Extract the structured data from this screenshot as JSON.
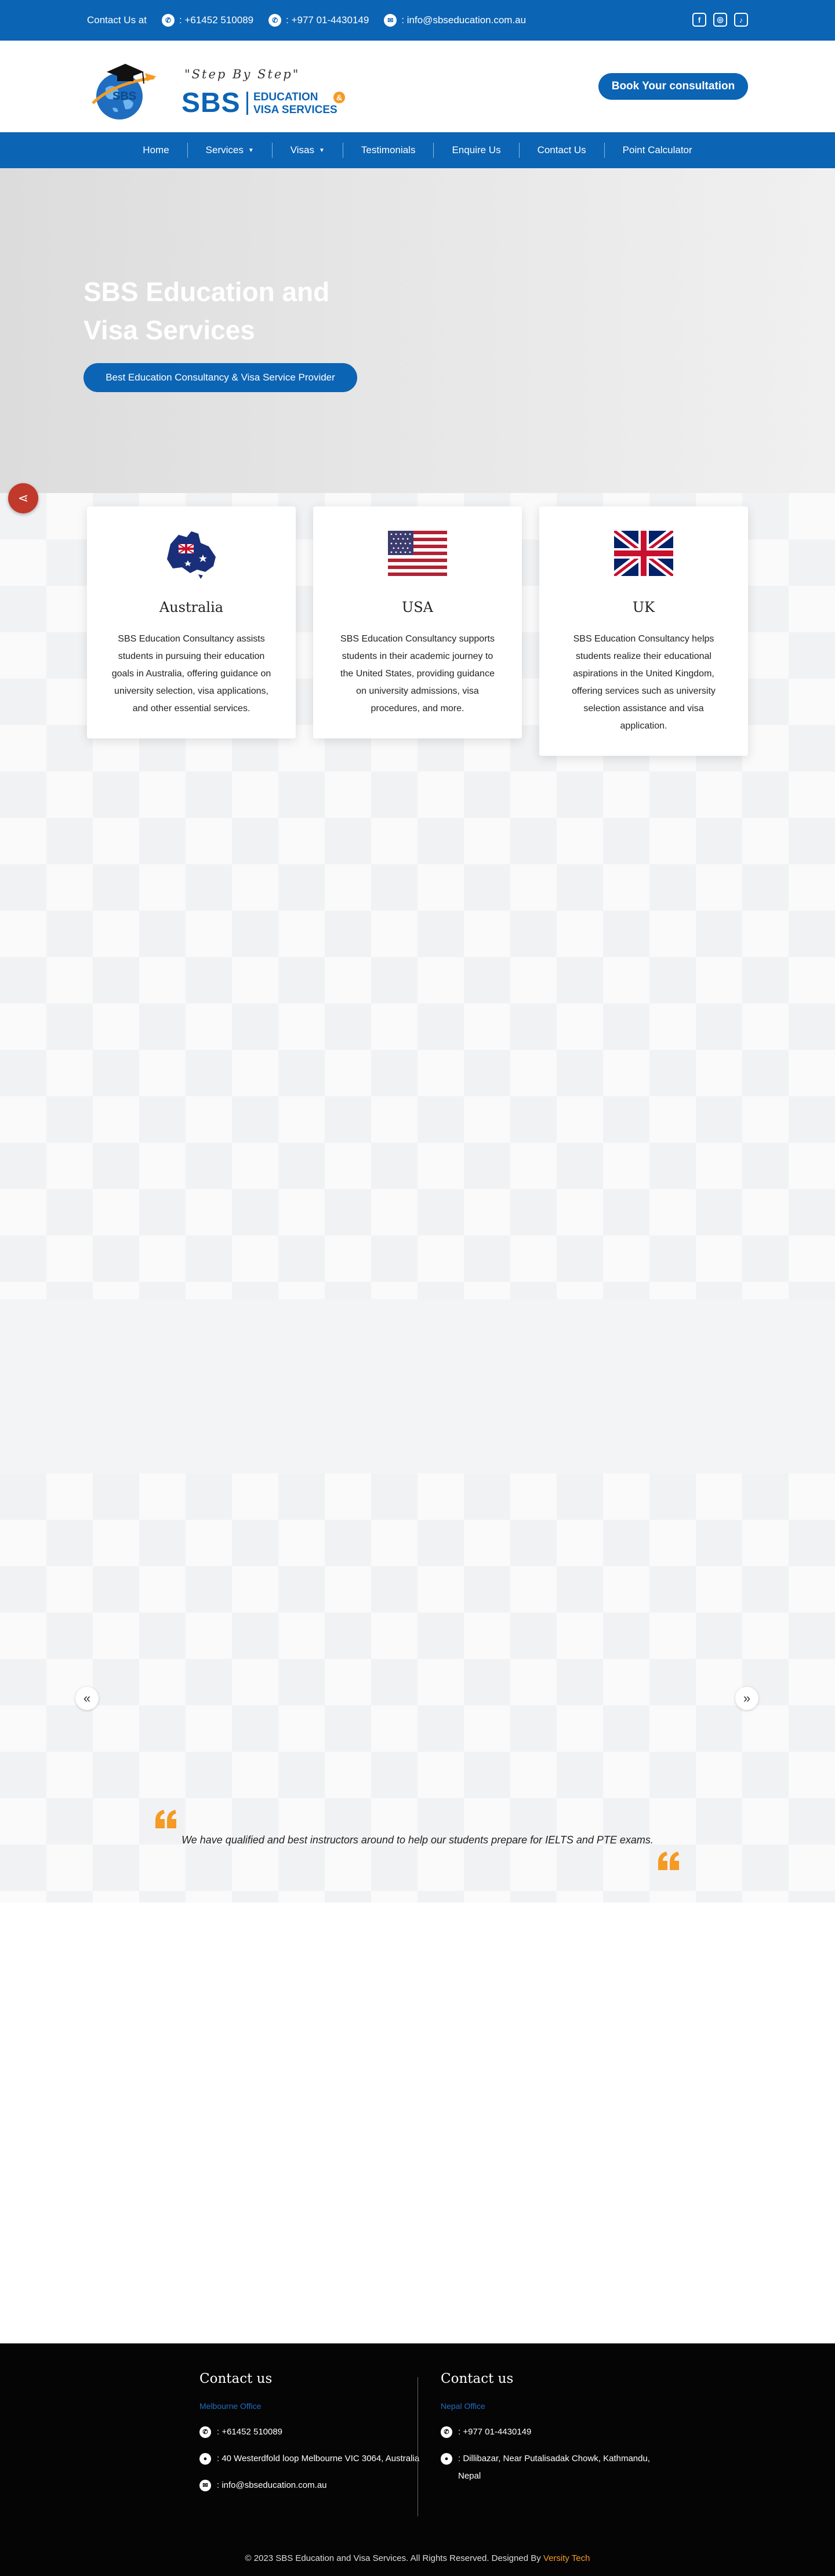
{
  "topbar": {
    "contact_label": "Contact Us at",
    "phone_au": ": +61452 510089",
    "phone_np": ": +977 01-4430149",
    "email": ": info@sbseducation.com.au",
    "social": [
      "facebook-icon",
      "instagram-icon",
      "tiktok-icon"
    ]
  },
  "header": {
    "tagline": "\"Step By Step\"",
    "brand": "SBS",
    "brand_line1": "EDUCATION",
    "brand_line2": "VISA SERVICES",
    "amp": "&",
    "book_button": "Book Your consultation"
  },
  "nav": {
    "items": [
      "Home",
      "Services",
      "Visas",
      "Testimonials",
      "Enquire Us",
      "Contact Us",
      "Point Calculator"
    ]
  },
  "hero": {
    "title": "SBS Education and Visa Services",
    "button": "Best Education Consultancy & Visa Service Provider"
  },
  "cards": [
    {
      "name": "Australia",
      "text": "SBS Education Consultancy assists students in pursuing their education goals in Australia, offering guidance on university selection, visa applications, and other essential services."
    },
    {
      "name": "USA",
      "text": "SBS Education Consultancy supports students in their academic journey to the United States, providing guidance on university admissions, visa procedures, and more."
    },
    {
      "name": "UK",
      "text": "SBS Education Consultancy helps students realize their educational aspirations in the United Kingdom, offering services such as university selection assistance and visa application."
    }
  ],
  "slider": {
    "prev": "«",
    "next": "»"
  },
  "testimonial": {
    "quote": "We have qualified and best instructors around to help our students prepare for IELTS and PTE exams."
  },
  "footer": {
    "left": {
      "heading": "Contact us",
      "office": "Melbourne Office",
      "phone": ": +61452 510089",
      "address": ": 40 Westerdfold loop Melbourne VIC 3064, Australia",
      "email": ": info@sbseducation.com.au"
    },
    "right": {
      "heading": "Contact us",
      "office": "Nepal Office",
      "phone": ": +977 01-4430149",
      "address": ": Dillibazar, Near Putalisadak Chowk, Kathmandu, Nepal"
    },
    "copyright": "© 2023 SBS Education and Visa Services. All Rights Reserved. Designed By",
    "designer": "Versity Tech"
  },
  "colors": {
    "primary": "#0c64b4",
    "accent": "#f59a23",
    "share": "#c0392b",
    "footer_bg": "#050505"
  }
}
